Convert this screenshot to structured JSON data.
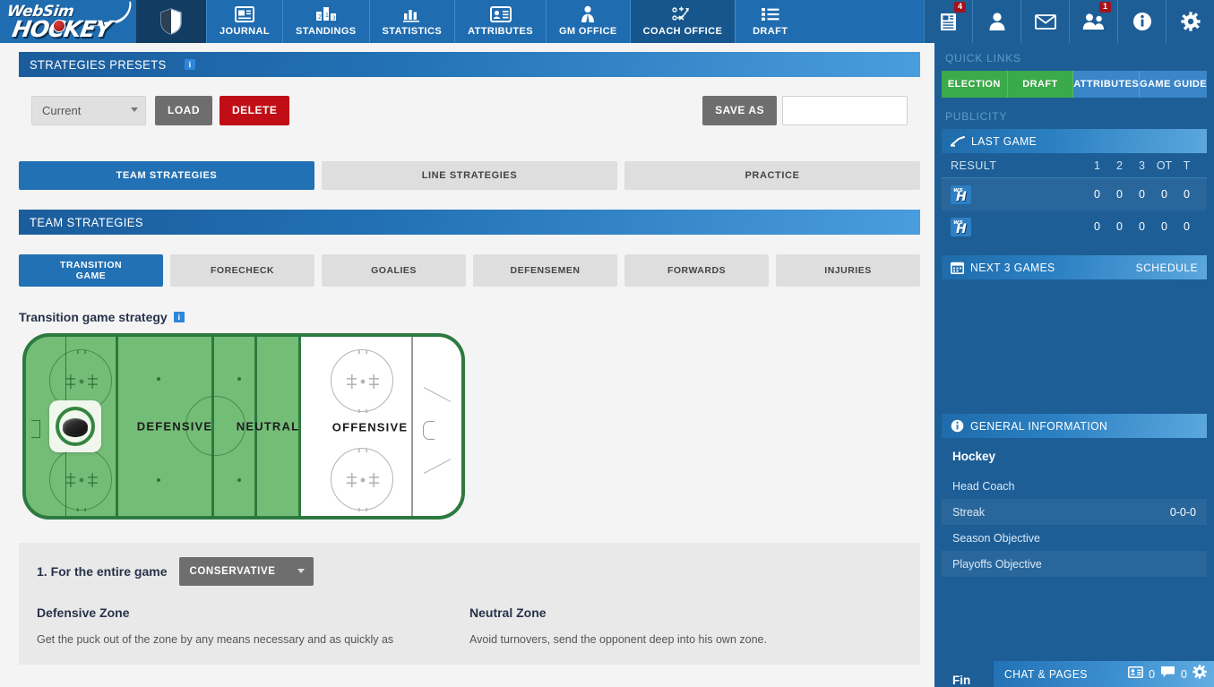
{
  "brand": {
    "line1": "WebSim",
    "line2": "HOCKEY"
  },
  "topnav": {
    "items": [
      {
        "label": "",
        "icon": "shield-icon",
        "active": true,
        "shield": true
      },
      {
        "label": "JOURNAL",
        "icon": "journal-icon",
        "active": false
      },
      {
        "label": "STANDINGS",
        "icon": "standings-icon",
        "active": false
      },
      {
        "label": "STATISTICS",
        "icon": "statistics-icon",
        "active": false
      },
      {
        "label": "ATTRIBUTES",
        "icon": "attributes-icon",
        "active": false
      },
      {
        "label": "GM OFFICE",
        "icon": "gm-office-icon",
        "active": false
      },
      {
        "label": "COACH OFFICE",
        "icon": "coach-office-icon",
        "active": true
      },
      {
        "label": "DRAFT",
        "icon": "draft-icon",
        "active": false
      }
    ],
    "right_icons": [
      {
        "name": "news-icon",
        "badge": "4"
      },
      {
        "name": "profile-icon",
        "badge": ""
      },
      {
        "name": "mail-icon",
        "badge": ""
      },
      {
        "name": "friends-icon",
        "badge": "1"
      },
      {
        "name": "info-icon",
        "badge": ""
      },
      {
        "name": "settings-gear-icon",
        "badge": ""
      }
    ]
  },
  "presets": {
    "title": "STRATEGIES PRESETS",
    "selected": "Current",
    "load_label": "LOAD",
    "delete_label": "DELETE",
    "save_as_label": "SAVE AS",
    "save_as_value": "",
    "save_as_placeholder": ""
  },
  "main_tabs": [
    {
      "label": "TEAM STRATEGIES",
      "active": true
    },
    {
      "label": "LINE STRATEGIES",
      "active": false
    },
    {
      "label": "PRACTICE",
      "active": false
    }
  ],
  "section": {
    "title": "TEAM STRATEGIES"
  },
  "sub_tabs": [
    {
      "label": "TRANSITION GAME",
      "line1": "TRANSITION",
      "line2": "GAME",
      "active": true
    },
    {
      "label": "FORECHECK",
      "line1": "FORECHECK",
      "line2": "",
      "active": false
    },
    {
      "label": "GOALIES",
      "line1": "GOALIES",
      "line2": "",
      "active": false
    },
    {
      "label": "DEFENSEMEN",
      "line1": "DEFENSEMEN",
      "line2": "",
      "active": false
    },
    {
      "label": "FORWARDS",
      "line1": "FORWARDS",
      "line2": "",
      "active": false
    },
    {
      "label": "INJURIES",
      "line1": "INJURIES",
      "line2": "",
      "active": false
    }
  ],
  "rink": {
    "heading": "Transition game strategy",
    "zones": [
      {
        "name": "DEFENSIVE",
        "active": true
      },
      {
        "name": "NEUTRAL",
        "active": true
      },
      {
        "name": "OFFENSIVE",
        "active": false
      }
    ],
    "slider_position": "defensive",
    "active_color": "#74bd77",
    "inactive_color": "#ffffff"
  },
  "strategy_card": {
    "question": "1. For the entire game",
    "selected": "CONSERVATIVE",
    "columns": [
      {
        "heading": "Defensive Zone",
        "text": "Get the puck out of the zone by any means necessary and as quickly as"
      },
      {
        "heading": "Neutral Zone",
        "text": "Avoid turnovers, send the opponent deep into his own zone."
      }
    ]
  },
  "sidebar": {
    "quick_links_caption": "QUICK LINKS",
    "quick_links": [
      {
        "label": "ELECTION",
        "style": "green"
      },
      {
        "label": "DRAFT",
        "style": "green"
      },
      {
        "label": "ATTRIBUTES",
        "style": "blue"
      },
      {
        "label": "GAME GUIDE",
        "style": "blue"
      }
    ],
    "publicity_caption": "PUBLICITY",
    "last_game": {
      "title": "LAST GAME",
      "result_label": "RESULT",
      "columns": [
        "1",
        "2",
        "3",
        "OT",
        "T"
      ],
      "rows": [
        {
          "team": "WS H",
          "scores": [
            "0",
            "0",
            "0",
            "0",
            "0"
          ]
        },
        {
          "team": "WS H",
          "scores": [
            "0",
            "0",
            "0",
            "0",
            "0"
          ]
        }
      ]
    },
    "next_games": {
      "title": "NEXT 3 GAMES",
      "link": "SCHEDULE"
    },
    "general_info": {
      "title": "GENERAL INFORMATION",
      "league": "Hockey",
      "rows": [
        {
          "label": "Head Coach",
          "value": ""
        },
        {
          "label": "Streak",
          "value": "0-0-0"
        },
        {
          "label": "Season Objective",
          "value": ""
        },
        {
          "label": "Playoffs Objective",
          "value": ""
        }
      ],
      "cut_row": "Fin"
    },
    "chat": {
      "title": "CHAT & PAGES",
      "contacts": "0",
      "messages": "0"
    }
  }
}
